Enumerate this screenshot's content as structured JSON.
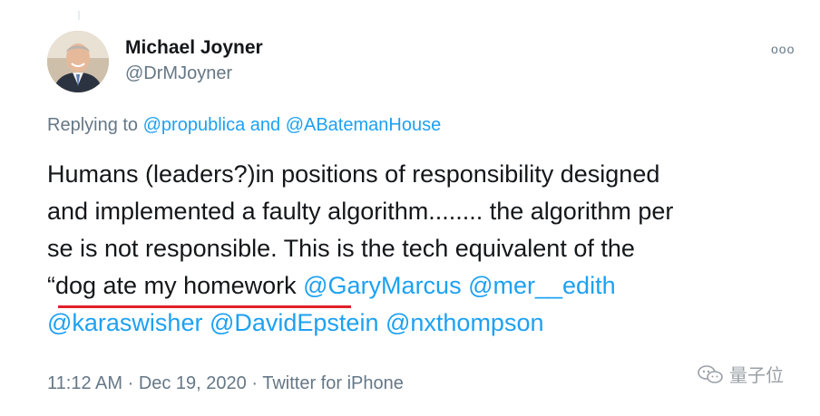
{
  "tweet": {
    "author_name": "Michael Joyner",
    "author_handle": "@DrMJoyner",
    "more_icon": "ellipsis-icon",
    "more_label": "ooo",
    "reply": {
      "prefix": "Replying to ",
      "user1": "@propublica",
      "conj": " and ",
      "user2": "@ABatemanHouse"
    },
    "body": {
      "line1": "Humans (leaders?)in positions of responsibility designed",
      "line2": "and implemented a faulty algorithm........ the algorithm per",
      "line3": "se is not responsible.  This is the tech equivalent of the",
      "line4_text": "“dog ate my homework",
      "line4_m1": "@GaryMarcus",
      "line4_m2": "@mer__edith",
      "line5_m1": "@karaswisher",
      "line5_m2": "@DavidEpstein",
      "line5_m3": "@nxthompson"
    },
    "meta": {
      "time": "11:12 AM",
      "date": "Dec 19, 2020",
      "source": "Twitter for iPhone",
      "sep": " · "
    }
  },
  "watermark": {
    "icon": "wechat-icon",
    "text": "量子位"
  },
  "colors": {
    "link": "#1da1f2",
    "muted": "#657786",
    "underline": "#e0202a"
  }
}
